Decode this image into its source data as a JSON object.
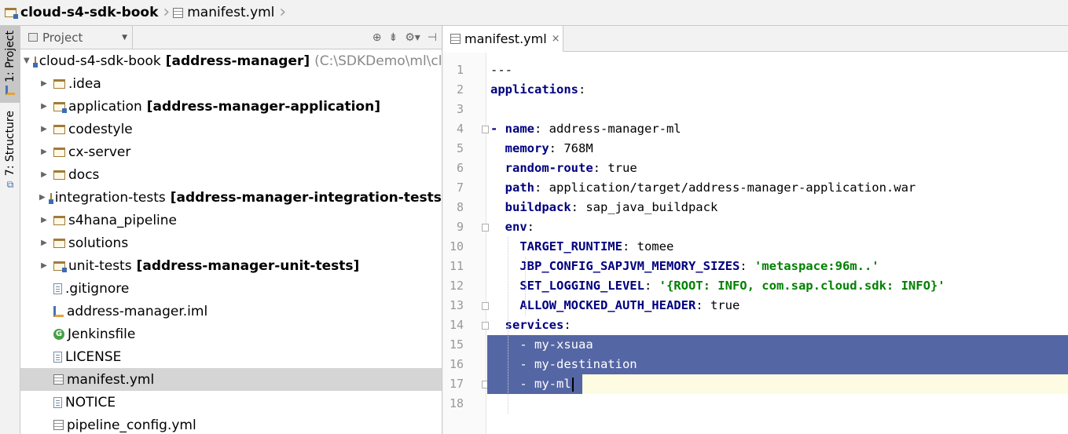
{
  "breadcrumb": {
    "project": "cloud-s4-sdk-book",
    "file": "manifest.yml"
  },
  "toolstrip": {
    "project_tab": "1: Project",
    "structure_tab": "7: Structure"
  },
  "project_panel": {
    "selector_label": "Project",
    "root": {
      "name": "cloud-s4-sdk-book",
      "module": "[address-manager]",
      "path": "(C:\\SDKDemo\\ml\\clou"
    },
    "items": [
      {
        "name": ".idea",
        "module": "",
        "icon": "folder-icon",
        "expandable": true
      },
      {
        "name": "application",
        "module": "[address-manager-application]",
        "icon": "module-folder-icon",
        "expandable": true
      },
      {
        "name": "codestyle",
        "module": "",
        "icon": "folder-icon",
        "expandable": true
      },
      {
        "name": "cx-server",
        "module": "",
        "icon": "folder-icon",
        "expandable": true
      },
      {
        "name": "docs",
        "module": "",
        "icon": "folder-icon",
        "expandable": true
      },
      {
        "name": "integration-tests",
        "module": "[address-manager-integration-tests]",
        "icon": "module-folder-icon",
        "expandable": true
      },
      {
        "name": "s4hana_pipeline",
        "module": "",
        "icon": "folder-icon",
        "expandable": true
      },
      {
        "name": "solutions",
        "module": "",
        "icon": "folder-icon",
        "expandable": true
      },
      {
        "name": "unit-tests",
        "module": "[address-manager-unit-tests]",
        "icon": "module-folder-icon",
        "expandable": true
      },
      {
        "name": ".gitignore",
        "module": "",
        "icon": "text-file-icon",
        "expandable": false
      },
      {
        "name": "address-manager.iml",
        "module": "",
        "icon": "iml-file-icon",
        "expandable": false
      },
      {
        "name": "Jenkinsfile",
        "module": "",
        "icon": "groovy-file-icon",
        "expandable": false
      },
      {
        "name": "LICENSE",
        "module": "",
        "icon": "text-file-icon",
        "expandable": false
      },
      {
        "name": "manifest.yml",
        "module": "",
        "icon": "yaml-file-icon",
        "expandable": false,
        "selected": true
      },
      {
        "name": "NOTICE",
        "module": "",
        "icon": "text-file-icon",
        "expandable": false
      },
      {
        "name": "pipeline_config.yml",
        "module": "",
        "icon": "yaml-file-icon",
        "expandable": false
      }
    ]
  },
  "editor": {
    "tab_label": "manifest.yml",
    "close_glyph": "×",
    "lines": [
      {
        "n": "1",
        "parts": [
          [
            "v",
            "---"
          ]
        ]
      },
      {
        "n": "2",
        "parts": [
          [
            "k",
            "applications"
          ],
          [
            "v",
            ":"
          ]
        ]
      },
      {
        "n": "3",
        "parts": []
      },
      {
        "n": "4",
        "parts": [
          [
            "dash",
            "- "
          ],
          [
            "k",
            "name"
          ],
          [
            "v",
            ": address-manager-ml"
          ]
        ]
      },
      {
        "n": "5",
        "parts": [
          [
            "v",
            "  "
          ],
          [
            "k",
            "memory"
          ],
          [
            "v",
            ": 768M"
          ]
        ]
      },
      {
        "n": "6",
        "parts": [
          [
            "v",
            "  "
          ],
          [
            "k",
            "random-route"
          ],
          [
            "v",
            ": true"
          ]
        ]
      },
      {
        "n": "7",
        "parts": [
          [
            "v",
            "  "
          ],
          [
            "k",
            "path"
          ],
          [
            "v",
            ": application/target/address-manager-application.war"
          ]
        ]
      },
      {
        "n": "8",
        "parts": [
          [
            "v",
            "  "
          ],
          [
            "k",
            "buildpack"
          ],
          [
            "v",
            ": sap_java_buildpack"
          ]
        ]
      },
      {
        "n": "9",
        "parts": [
          [
            "v",
            "  "
          ],
          [
            "k",
            "env"
          ],
          [
            "v",
            ":"
          ]
        ]
      },
      {
        "n": "10",
        "parts": [
          [
            "v",
            "    "
          ],
          [
            "k",
            "TARGET_RUNTIME"
          ],
          [
            "v",
            ": tomee"
          ]
        ]
      },
      {
        "n": "11",
        "parts": [
          [
            "v",
            "    "
          ],
          [
            "k",
            "JBP_CONFIG_SAPJVM_MEMORY_SIZES"
          ],
          [
            "v",
            ": "
          ],
          [
            "s",
            "'metaspace:96m..'"
          ]
        ]
      },
      {
        "n": "12",
        "parts": [
          [
            "v",
            "    "
          ],
          [
            "k",
            "SET_LOGGING_LEVEL"
          ],
          [
            "v",
            ": "
          ],
          [
            "s",
            "'{ROOT: INFO, com.sap.cloud.sdk: INFO}'"
          ]
        ]
      },
      {
        "n": "13",
        "parts": [
          [
            "v",
            "    "
          ],
          [
            "k",
            "ALLOW_MOCKED_AUTH_HEADER"
          ],
          [
            "v",
            ": true"
          ]
        ]
      },
      {
        "n": "14",
        "parts": [
          [
            "v",
            "  "
          ],
          [
            "k",
            "services"
          ],
          [
            "v",
            ":"
          ]
        ]
      },
      {
        "n": "15",
        "parts": [
          [
            "v",
            "    - my-xsuaa"
          ]
        ],
        "selected": true
      },
      {
        "n": "16",
        "parts": [
          [
            "v",
            "    - my-destination"
          ]
        ],
        "selected": true
      },
      {
        "n": "17",
        "parts": [
          [
            "v",
            "    - my-ml"
          ]
        ],
        "selected": true,
        "current": true
      },
      {
        "n": "18",
        "parts": []
      }
    ]
  },
  "colors": {
    "keyword": "#000080",
    "string": "#008000",
    "selection": "#5566a5",
    "current_line": "#fefbe3"
  }
}
